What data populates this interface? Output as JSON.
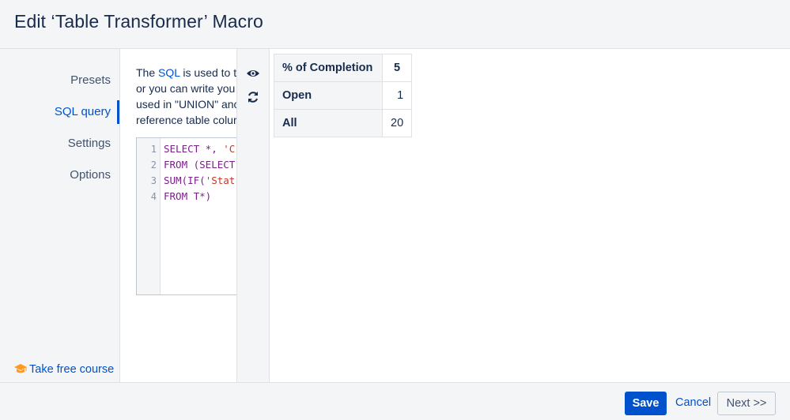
{
  "dialog": {
    "title": "Edit ‘Table Transformer’ Macro"
  },
  "sidebar": {
    "items": [
      {
        "label": "Presets"
      },
      {
        "label": "SQL query"
      },
      {
        "label": "Settings"
      },
      {
        "label": "Options"
      }
    ],
    "course_link": "Take free course"
  },
  "description": {
    "line1_pre": "The ",
    "line1_link": "SQL",
    "line1_post": " is used to t",
    "line2": "or you can write you",
    "line3": "used in \"UNION\" anc",
    "line4": "reference table colur"
  },
  "code": {
    "line_numbers": [
      "1",
      "2",
      "3",
      "4"
    ],
    "lines": [
      {
        "kw": "SELECT *, ",
        "str": "'C"
      },
      {
        "kw": "FROM (SELECT"
      },
      {
        "kw": "SUM(IF(",
        "str": "'Stat"
      },
      {
        "kw": "FROM T*)"
      }
    ]
  },
  "icons": {
    "preview": "eye-icon",
    "refresh": "refresh-icon",
    "course": "graduation-cap-icon"
  },
  "preview_table": {
    "rows": [
      {
        "label": "% of Completion",
        "value": "5"
      },
      {
        "label": "Open",
        "value": "1"
      },
      {
        "label": "All",
        "value": "20"
      }
    ]
  },
  "footer": {
    "save": "Save",
    "cancel": "Cancel",
    "next": "Next >>"
  },
  "colors": {
    "accent": "#0052cc",
    "course_icon": "#ff991f",
    "sql_keyword": "#7a1f8a",
    "sql_string": "#c0392b"
  }
}
